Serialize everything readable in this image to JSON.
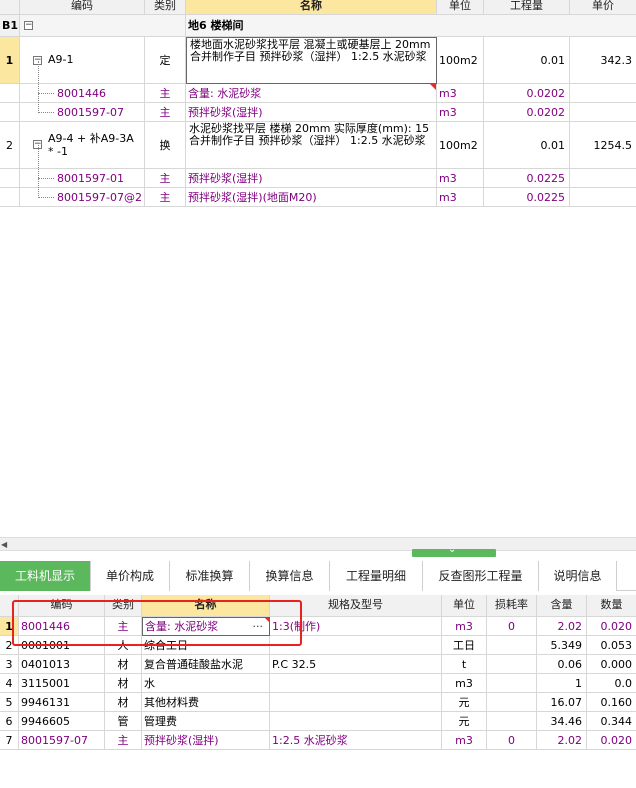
{
  "top_grid": {
    "headers": [
      "编码",
      "类别",
      "名称",
      "单位",
      "工程量",
      "单价"
    ],
    "section": {
      "id": "B1",
      "toggle": "−",
      "name": "地6  楼梯间"
    },
    "rows": [
      {
        "num": "1",
        "code": "A9-1",
        "type": "定",
        "name": "楼地面水泥砂浆找平层 混凝土或硬基层上 20mm  合并制作子目 预拌砂浆（湿拌） 1:2.5 水泥砂浆",
        "unit": "100m2",
        "qty": "0.01",
        "price": "342.3"
      },
      {
        "num": "",
        "code": "8001446",
        "type": "主",
        "name": "含量: 水泥砂浆",
        "unit": "m3",
        "qty": "0.0202",
        "price": ""
      },
      {
        "num": "",
        "code": "8001597-07",
        "type": "主",
        "name": "预拌砂浆(湿拌)",
        "unit": "m3",
        "qty": "0.0202",
        "price": ""
      },
      {
        "num": "2",
        "code": "A9-4 + 补A9-3A * -1",
        "type": "换",
        "name": "水泥砂浆找平层 楼梯 20mm  实际厚度(mm): 15  合并制作子目 预拌砂浆（湿拌） 1:2.5 水泥砂浆",
        "unit": "100m2",
        "qty": "0.01",
        "price": "1254.5"
      },
      {
        "num": "",
        "code": "8001597-01",
        "type": "主",
        "name": "预拌砂浆(湿拌)",
        "unit": "m3",
        "qty": "0.0225",
        "price": ""
      },
      {
        "num": "",
        "code": "8001597-07@2",
        "type": "主",
        "name": "预拌砂浆(湿拌)(地面M20)",
        "unit": "m3",
        "qty": "0.0225",
        "price": ""
      }
    ]
  },
  "tabs": [
    "工料机显示",
    "单价构成",
    "标准换算",
    "换算信息",
    "工程量明细",
    "反查图形工程量",
    "说明信息"
  ],
  "bottom_grid": {
    "headers": [
      "编码",
      "类别",
      "名称",
      "规格及型号",
      "单位",
      "损耗率",
      "含量",
      "数量"
    ],
    "rows": [
      {
        "num": "1",
        "code": "8001446",
        "type": "主",
        "name": "含量: 水泥砂浆",
        "spec": "1:3(制作)",
        "unit": "m3",
        "loss": "0",
        "content": "2.02",
        "qty": "0.020"
      },
      {
        "num": "2",
        "code": "0001001",
        "type": "人",
        "name": "综合工日",
        "spec": "",
        "unit": "工日",
        "loss": "",
        "content": "5.349",
        "qty": "0.053"
      },
      {
        "num": "3",
        "code": "0401013",
        "type": "材",
        "name": "复合普通硅酸盐水泥",
        "spec": "P.C 32.5",
        "unit": "t",
        "loss": "",
        "content": "0.06",
        "qty": "0.000"
      },
      {
        "num": "4",
        "code": "3115001",
        "type": "材",
        "name": "水",
        "spec": "",
        "unit": "m3",
        "loss": "",
        "content": "1",
        "qty": "0.0"
      },
      {
        "num": "5",
        "code": "9946131",
        "type": "材",
        "name": "其他材料费",
        "spec": "",
        "unit": "元",
        "loss": "",
        "content": "16.07",
        "qty": "0.160"
      },
      {
        "num": "6",
        "code": "9946605",
        "type": "管",
        "name": "管理费",
        "spec": "",
        "unit": "元",
        "loss": "",
        "content": "34.46",
        "qty": "0.344"
      },
      {
        "num": "7",
        "code": "8001597-07",
        "type": "主",
        "name": "预拌砂浆(湿拌)",
        "spec": "1:2.5 水泥砂浆",
        "unit": "m3",
        "loss": "0",
        "content": "2.02",
        "qty": "0.020"
      }
    ]
  },
  "misc": {
    "scroll_left_arrow": "◀",
    "splitter_arrow": "⌄",
    "ellipsis": "···"
  }
}
